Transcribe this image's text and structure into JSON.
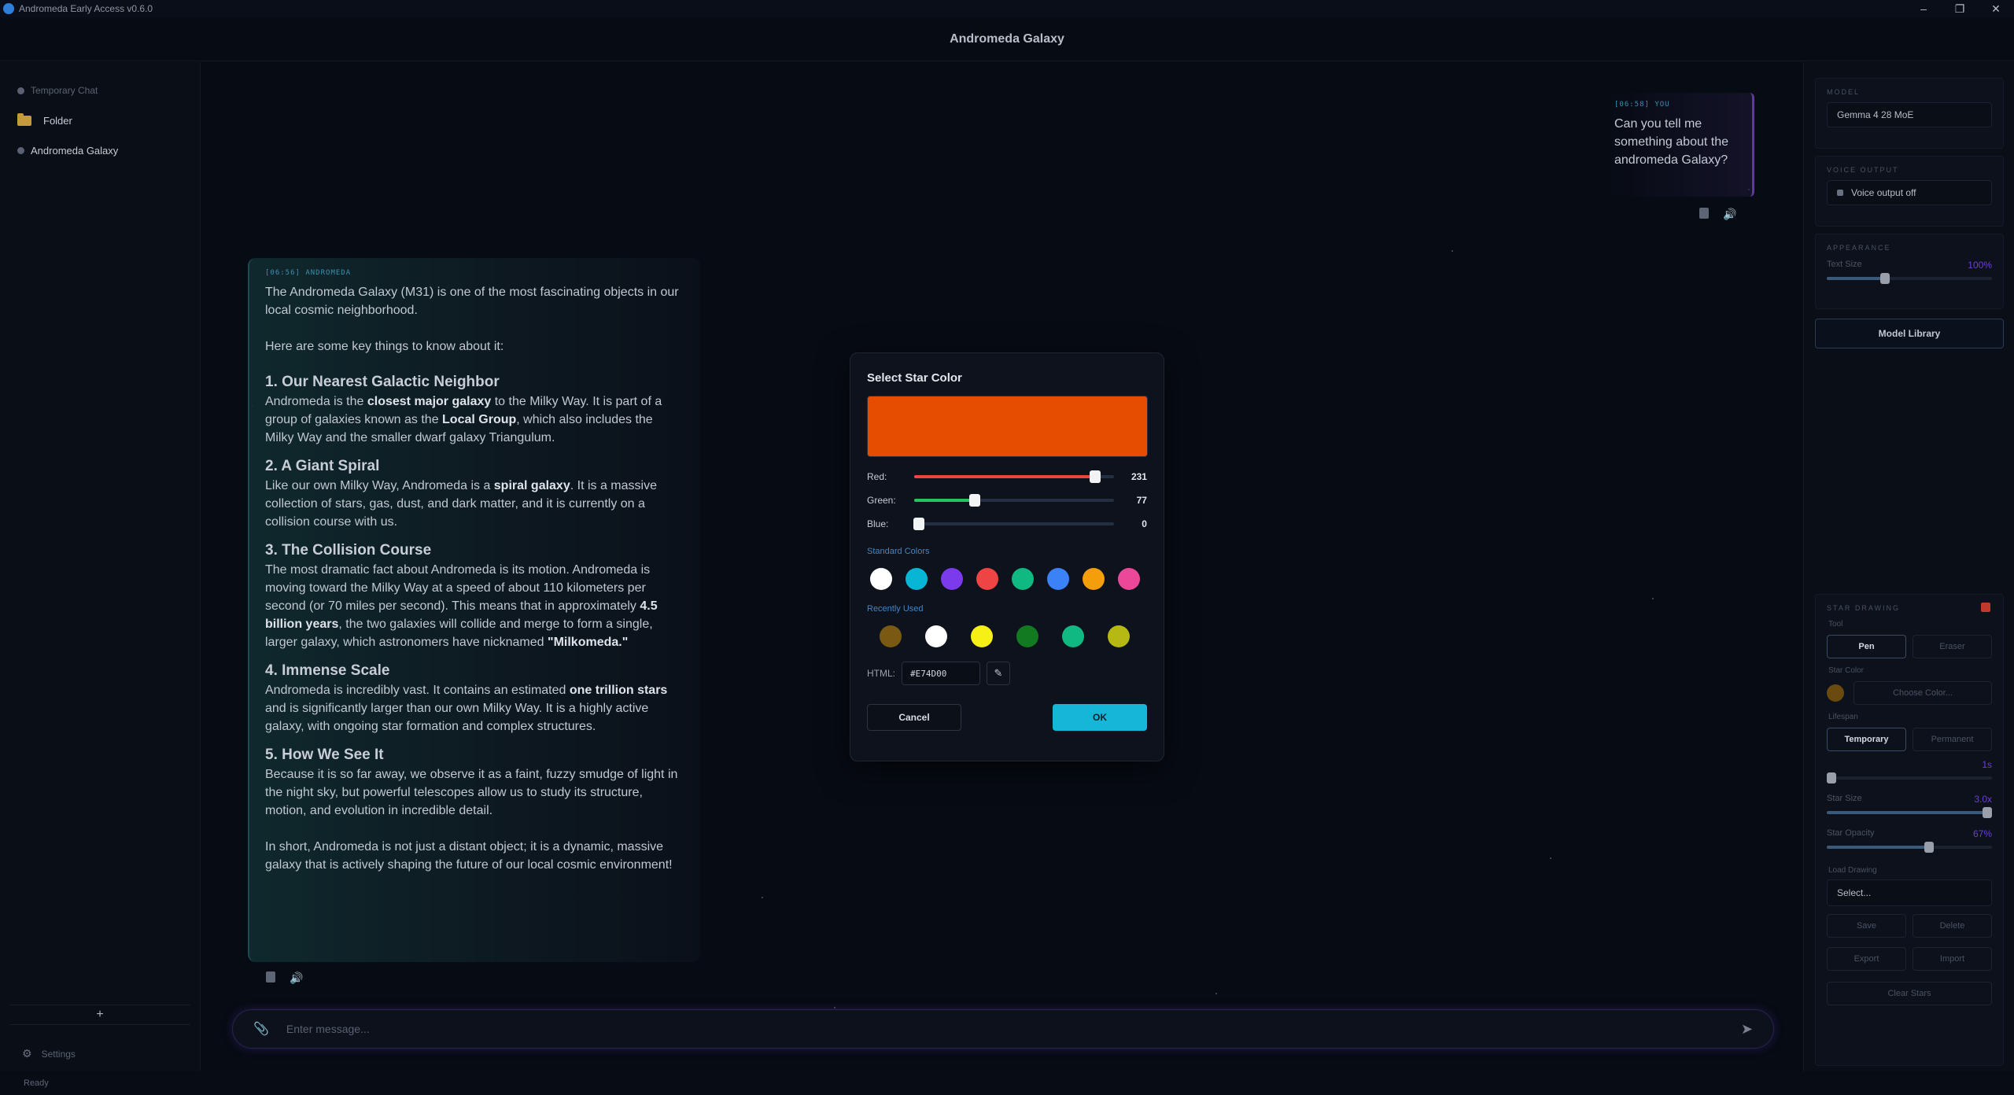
{
  "window": {
    "title": "Andromeda Early Access v0.6.0"
  },
  "header": {
    "title": "Andromeda Galaxy"
  },
  "sidebar": {
    "items": [
      {
        "label": "Temporary Chat"
      },
      {
        "label": "Folder"
      },
      {
        "label": "Andromeda Galaxy"
      }
    ],
    "new_label": "+",
    "settings_label": "Settings"
  },
  "chat": {
    "user_msg": {
      "meta": "[06:58] YOU",
      "text": "Can you tell me something about the andromeda Galaxy?"
    },
    "bot_msg": {
      "meta": "[06:56] ANDROMEDA",
      "intro": "The Andromeda Galaxy (M31) is one of the most fascinating objects in our local cosmic neighborhood.",
      "lead": "Here are some key things to know about it:",
      "s1_title": "1. Our Nearest Galactic Neighbor",
      "s1_a": "Andromeda is the ",
      "s1_b": "closest major galaxy",
      "s1_c": " to the Milky Way. It is part of a group of galaxies known as the ",
      "s1_d": "Local Group",
      "s1_e": ", which also includes the Milky Way and the smaller dwarf galaxy Triangulum.",
      "s2_title": "2. A Giant Spiral",
      "s2_a": "Like our own Milky Way, Andromeda is a ",
      "s2_b": "spiral galaxy",
      "s2_c": ". It is a massive collection of stars, gas, dust, and dark matter, and it is currently on a collision course with us.",
      "s3_title": "3. The Collision Course",
      "s3_a": "The most dramatic fact about Andromeda is its motion. Andromeda is moving toward the Milky Way at a speed of about 110 kilometers per second (or 70 miles per second). This means that in approximately ",
      "s3_b": "4.5 billion years",
      "s3_c": ", the two galaxies will collide and merge to form a single, larger galaxy, which astronomers have nicknamed ",
      "s3_d": "\"Milkomeda.\"",
      "s4_title": "4. Immense Scale",
      "s4_a": "Andromeda is incredibly vast. It contains an estimated ",
      "s4_b": "one trillion stars",
      "s4_c": " and is significantly larger than our own Milky Way. It is a highly active galaxy, with ongoing star formation and complex structures.",
      "s5_title": "5. How We See It",
      "s5_a": "Because it is so far away, we observe it as a faint, fuzzy smudge of light in the night sky, but powerful telescopes allow us to study its structure, motion, and evolution in incredible detail.",
      "outro": "In short, Andromeda is not just a distant object; it is a dynamic, massive galaxy that is actively shaping the future of our local cosmic environment!"
    },
    "input_placeholder": "Enter message..."
  },
  "status": "Ready",
  "right_panel": {
    "model_label": "MODEL",
    "model_value": "Gemma 4 28 MoE",
    "voice_label": "VOICE OUTPUT",
    "voice_value": "Voice output off",
    "appearance_label": "APPEARANCE",
    "text_size_label": "Text Size",
    "text_size_value": "100%",
    "text_size_level": 0.35,
    "model_library": "Model Library",
    "star_drawing_label": "STAR DRAWING",
    "tool_label": "Tool",
    "pen": "Pen",
    "eraser": "Eraser",
    "star_color_label": "Star Color",
    "choose_color": "Choose Color...",
    "lifespan_label": "Lifespan",
    "temporary": "Temporary",
    "permanent": "Permanent",
    "lifespan_value": "1s",
    "lifespan_level": 0.03,
    "star_size_label": "Star Size",
    "star_size_value": "3.0x",
    "star_size_level": 0.97,
    "star_opacity_label": "Star Opacity",
    "star_opacity_value": "67%",
    "star_opacity_level": 0.62,
    "load_drawing_label": "Load Drawing",
    "load_select": "Select...",
    "save": "Save",
    "delete": "Delete",
    "export": "Export",
    "import": "Import",
    "clear_stars": "Clear Stars"
  },
  "dialog": {
    "title": "Select Star Color",
    "preview_color": "#E74D00",
    "red_label": "Red:",
    "red_value": "231",
    "red": 231,
    "green_label": "Green:",
    "green_value": "77",
    "green": 77,
    "blue_label": "Blue:",
    "blue_value": "0",
    "blue": 0,
    "standard_label": "Standard Colors",
    "standard_colors": [
      "#ffffff",
      "#06b6d4",
      "#7c3aed",
      "#ef4444",
      "#10b981",
      "#3b82f6",
      "#f59e0b",
      "#ec4899"
    ],
    "recent_label": "Recently Used",
    "recent_colors": [
      "#7a5a12",
      "#ffffff",
      "#f7f016",
      "#127a20",
      "#10b981",
      "#b6b814"
    ],
    "html_label": "HTML:",
    "html_value": "#E74D00",
    "cancel": "Cancel",
    "ok": "OK"
  }
}
